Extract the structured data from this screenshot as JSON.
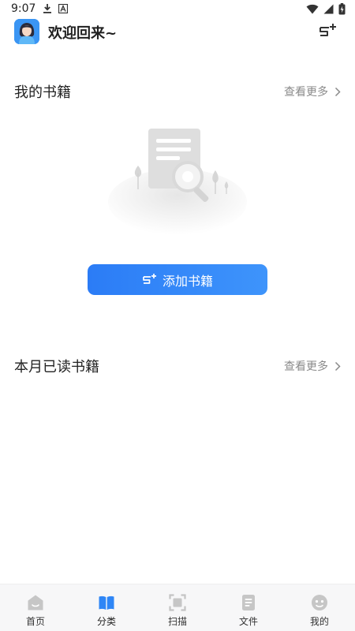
{
  "status_bar": {
    "time": "9:07",
    "icons": [
      "download-icon",
      "font-a-icon",
      "wifi-icon",
      "cellular-signal-icon",
      "battery-charging-icon"
    ]
  },
  "header": {
    "welcome_text": "欢迎回来~",
    "avatar": "avatar-icon",
    "add_icon": "add-book-icon"
  },
  "my_books": {
    "title": "我的书籍",
    "more_label": "查看更多",
    "add_button_label": "添加书籍"
  },
  "monthly_read": {
    "title": "本月已读书籍",
    "more_label": "查看更多"
  },
  "bottom_nav": {
    "active": "分类",
    "items": [
      {
        "label": "首页",
        "icon": "home-icon"
      },
      {
        "label": "分类",
        "icon": "category-book-icon"
      },
      {
        "label": "扫描",
        "icon": "scan-icon"
      },
      {
        "label": "文件",
        "icon": "file-icon"
      },
      {
        "label": "我的",
        "icon": "profile-face-icon"
      }
    ]
  },
  "colors": {
    "accent": "#2f86f6",
    "icon_gray": "#c4c4c4",
    "muted_text": "#8a8a8a"
  }
}
